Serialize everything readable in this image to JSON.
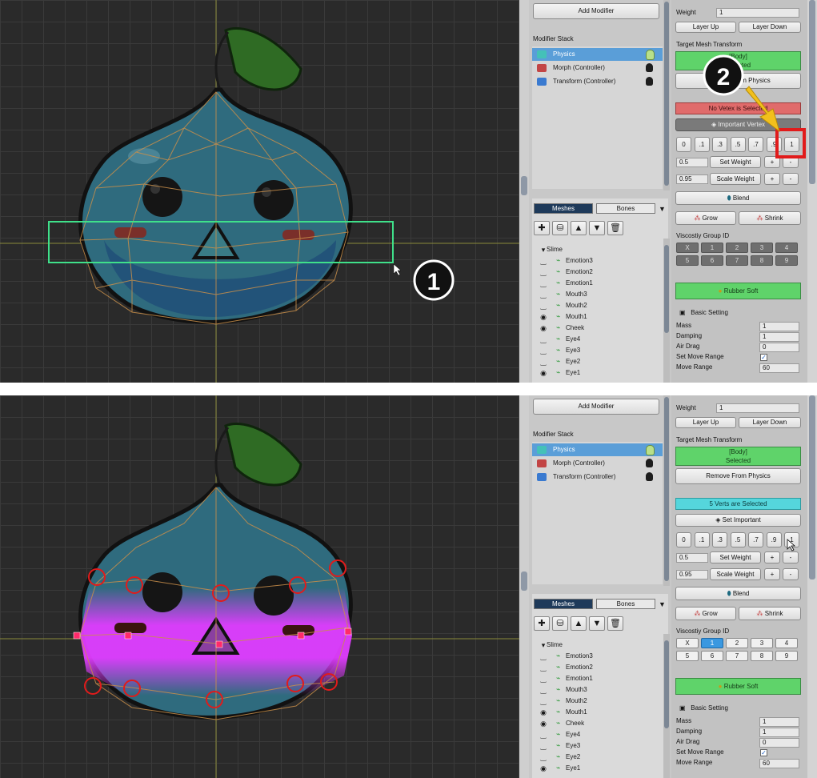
{
  "colors": {
    "viewport_bg": "#2a2a2a",
    "selection_green": "#5fd36a",
    "warning_red": "#e06b6b",
    "info_cyan": "#55d6dc",
    "accent_blue": "#3a98e0",
    "marker_yellow": "#f2c01c",
    "highlight_red": "#e11b1b",
    "vertex_pink": "#ff2a6a",
    "weight_magenta": "#e03cff"
  },
  "step_markers": {
    "first": "1",
    "second": "2"
  },
  "top": {
    "add_modifier": "Add Modifier",
    "weight_label": "Weight",
    "weight_value": "1",
    "layer_up": "Layer Up",
    "layer_down": "Layer Down",
    "modifier_stack_label": "Modifier Stack",
    "modifiers": [
      {
        "label": "Physics",
        "icon": "physics-icon"
      },
      {
        "label": "Morph (Controller)",
        "icon": "morph-icon"
      },
      {
        "label": "Transform (Controller)",
        "icon": "transform-icon"
      }
    ],
    "target_mesh_label": "Target Mesh Transform",
    "target_status_line1": "[Body]",
    "target_status_line2": "Selected",
    "remove_physics": "Remove From Physics",
    "vertex_status": "No Vetex is Selected",
    "important_button": "Important Vertex",
    "weight_presets": [
      "0",
      ".1",
      ".3",
      ".5",
      ".7",
      ".9",
      "1"
    ],
    "set_weight_value": "0.5",
    "set_weight": "Set Weight",
    "scale_weight_value": "0.95",
    "scale_weight": "Scale Weight",
    "plus": "+",
    "minus": "-",
    "blend": "Blend",
    "grow": "Grow",
    "shrink": "Shrink",
    "viscosity_label": "Viscostiy Group ID",
    "viscosity_buttons": [
      "X",
      "1",
      "2",
      "3",
      "4",
      "5",
      "6",
      "7",
      "8",
      "9"
    ],
    "preset": "Rubber Soft",
    "basic_setting": "Basic Setting",
    "props": [
      {
        "label": "Mass",
        "value": "1"
      },
      {
        "label": "Damping",
        "value": "1"
      },
      {
        "label": "Air Drag",
        "value": "0"
      },
      {
        "label": "Set Move Range",
        "value": ""
      },
      {
        "label": "Move Range",
        "value": "60"
      }
    ],
    "tabs": {
      "meshes": "Meshes",
      "bones": "Bones"
    },
    "tree_root": "Slime",
    "tree_items": [
      {
        "label": "Emotion3",
        "visible": false
      },
      {
        "label": "Emotion2",
        "visible": false
      },
      {
        "label": "Emotion1",
        "visible": false
      },
      {
        "label": "Mouth3",
        "visible": false
      },
      {
        "label": "Mouth2",
        "visible": false
      },
      {
        "label": "Mouth1",
        "visible": true
      },
      {
        "label": "Cheek",
        "visible": true
      },
      {
        "label": "Eye4",
        "visible": false
      },
      {
        "label": "Eye3",
        "visible": false
      },
      {
        "label": "Eye2",
        "visible": false
      },
      {
        "label": "Eye1",
        "visible": true
      }
    ]
  },
  "bottom": {
    "add_modifier": "Add Modifier",
    "weight_label": "Weight",
    "weight_value": "1",
    "layer_up": "Layer Up",
    "layer_down": "Layer Down",
    "modifier_stack_label": "Modifier Stack",
    "modifiers": [
      {
        "label": "Physics",
        "icon": "physics-icon"
      },
      {
        "label": "Morph (Controller)",
        "icon": "morph-icon"
      },
      {
        "label": "Transform (Controller)",
        "icon": "transform-icon"
      }
    ],
    "target_mesh_label": "Target Mesh Transform",
    "target_status_line1": "[Body]",
    "target_status_line2": "Selected",
    "remove_physics": "Remove From Physics",
    "vertex_status": "5 Verts are Selected",
    "important_button": "Set Important",
    "weight_presets": [
      "0",
      ".1",
      ".3",
      ".5",
      ".7",
      ".9",
      "1"
    ],
    "set_weight_value": "0.5",
    "set_weight": "Set Weight",
    "scale_weight_value": "0.95",
    "scale_weight": "Scale Weight",
    "plus": "+",
    "minus": "-",
    "blend": "Blend",
    "grow": "Grow",
    "shrink": "Shrink",
    "viscosity_label": "Viscostiy Group ID",
    "viscosity_buttons": [
      "X",
      "1",
      "2",
      "3",
      "4",
      "5",
      "6",
      "7",
      "8",
      "9"
    ],
    "preset": "Rubber Soft",
    "basic_setting": "Basic Setting",
    "props": [
      {
        "label": "Mass",
        "value": "1"
      },
      {
        "label": "Damping",
        "value": "1"
      },
      {
        "label": "Air Drag",
        "value": "0"
      },
      {
        "label": "Set Move Range",
        "value": ""
      },
      {
        "label": "Move Range",
        "value": "60"
      }
    ],
    "tabs": {
      "meshes": "Meshes",
      "bones": "Bones"
    },
    "tree_root": "Slime",
    "tree_items": [
      {
        "label": "Emotion3",
        "visible": false
      },
      {
        "label": "Emotion2",
        "visible": false
      },
      {
        "label": "Emotion1",
        "visible": false
      },
      {
        "label": "Mouth3",
        "visible": false
      },
      {
        "label": "Mouth2",
        "visible": false
      },
      {
        "label": "Mouth1",
        "visible": true
      },
      {
        "label": "Cheek",
        "visible": true
      },
      {
        "label": "Eye4",
        "visible": false
      },
      {
        "label": "Eye3",
        "visible": false
      },
      {
        "label": "Eye2",
        "visible": false
      },
      {
        "label": "Eye1",
        "visible": true
      }
    ]
  }
}
